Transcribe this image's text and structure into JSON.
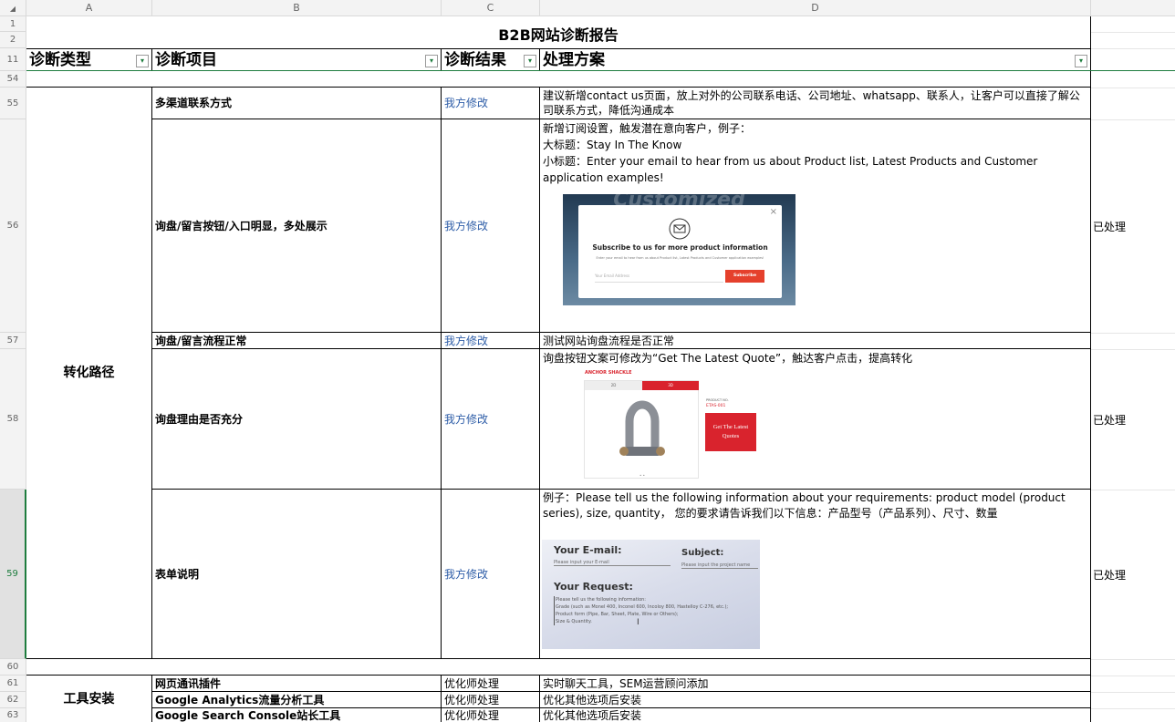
{
  "columns": [
    "A",
    "B",
    "C",
    "D"
  ],
  "rows": [
    "1",
    "2",
    "11",
    "54",
    "55",
    "56",
    "57",
    "58",
    "59",
    "60",
    "61",
    "62",
    "63"
  ],
  "title": "B2B网站诊断报告",
  "headers": {
    "type": "诊断类型",
    "item": "诊断项目",
    "result": "诊断结果",
    "solution": "处理方案"
  },
  "filter_icon": "▾",
  "groups": {
    "conversion": "转化路径",
    "tools": "工具安装"
  },
  "rows_data": {
    "r55": {
      "item": "多渠道联系方式",
      "result": "我方修改",
      "solution": "建议新增contact us页面，放上对外的公司联系电话、公司地址、whatsapp、联系人，让客户可以直接了解公司联系方式，降低沟通成本"
    },
    "r56": {
      "item": "询盘/留言按钮/入口明显，多处展示",
      "result": "我方修改",
      "sol_l1": "新增订阅设置，触发潜在意向客户，例子：",
      "sol_l2": "大标题：Stay In The Know",
      "sol_l3": "小标题：Enter your email to hear from us about Product list, Latest Products and Customer application examples!",
      "status": "已处理",
      "img": {
        "bg_text": "Customized",
        "popup_title": "Subscribe to us for more product information",
        "popup_sub": "Enter your email to hear from us about Product list, Latest Products and Customer application examples!",
        "email_placeholder": "Your Email Address",
        "subscribe_btn": "Subscribe",
        "close": "×"
      }
    },
    "r57": {
      "item": "询盘/留言流程正常",
      "result": "我方修改",
      "solution": "测试网站询盘流程是否正常"
    },
    "r58": {
      "item": "询盘理由是否充分",
      "result": "我方修改",
      "solution": "询盘按钮文案可修改为“Get The Latest Quote”，触达客户点击，提高转化",
      "status": "已处理",
      "img": {
        "heading": "ANCHOR SHACKLE",
        "tab1": "2D",
        "tab2": "3D",
        "product_no_label": "PRODUCT NO.",
        "product_no": "ETAS-001",
        "quote_btn": "Get The Latest Quotes"
      }
    },
    "r59": {
      "item": "表单说明",
      "result": "我方修改",
      "solution": "例子：Please tell us the following information about your requirements: product model (product series), size, quantity， 您的要求请告诉我们以下信息：产品型号（产品系列）、尺寸、数量",
      "status": "已处理",
      "img": {
        "email_label": "Your E-mail:",
        "email_ph": "Please input your E-mail",
        "subject_label": "Subject:",
        "subject_ph": "Please input the project name",
        "request_label": "Your Request:",
        "req_l1": "Please tell us the following information:",
        "req_l2": "Grade (such as Monel 400, Inconel 600, Incoloy 800, Hastelloy C-276, etc.);",
        "req_l3": "Product form (Pipe, Bar, Sheet, Plate, Wire or Others);",
        "req_l4": "Size & Quantity."
      }
    },
    "r61": {
      "item": "网页通讯插件",
      "result": "优化师处理",
      "solution": "实时聊天工具，SEM运营顾问添加"
    },
    "r62": {
      "item": "Google Analytics流量分析工具",
      "result": "优化师处理",
      "solution": "优化其他选项后安装"
    },
    "r63": {
      "item": "Google Search Console站长工具",
      "result": "优化师处理",
      "solution": "优化其他选项后安装"
    }
  },
  "colors": {
    "accent_green": "#1e7d3e",
    "link_blue": "#2f5ea8",
    "subscribe_red": "#e5402c",
    "quote_red": "#d9232d"
  }
}
